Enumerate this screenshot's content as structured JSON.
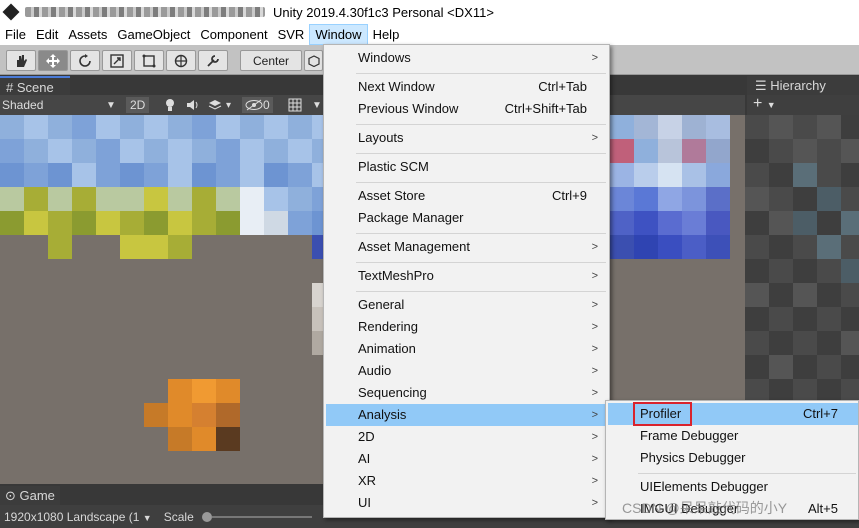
{
  "window": {
    "title": "Unity 2019.4.30f1c3 Personal <DX11>"
  },
  "menubar": {
    "items": [
      {
        "label": "File"
      },
      {
        "label": "Edit"
      },
      {
        "label": "Assets"
      },
      {
        "label": "GameObject"
      },
      {
        "label": "Component"
      },
      {
        "label": "SVR"
      },
      {
        "label": "Window"
      },
      {
        "label": "Help"
      }
    ]
  },
  "toolbar": {
    "pivot_label": "Center"
  },
  "scene": {
    "tab_label": "Scene",
    "shading_mode": "Shaded",
    "mode_2d": "2D",
    "hidden_count": "0"
  },
  "hierarchy": {
    "tab_label": "Hierarchy",
    "add_label": "+"
  },
  "game": {
    "tab_label": "Game",
    "resolution": "1920x1080 Landscape (1",
    "scale_label": "Scale"
  },
  "window_menu": {
    "items": [
      {
        "label": "Windows",
        "shortcut": "",
        "submenu": true
      },
      {
        "label": "Next Window",
        "shortcut": "Ctrl+Tab",
        "submenu": false
      },
      {
        "label": "Previous Window",
        "shortcut": "Ctrl+Shift+Tab",
        "submenu": false
      },
      {
        "label": "Layouts",
        "shortcut": "",
        "submenu": true
      },
      {
        "label": "Plastic SCM",
        "shortcut": "",
        "submenu": false
      },
      {
        "label": "Asset Store",
        "shortcut": "Ctrl+9",
        "submenu": false
      },
      {
        "label": "Package Manager",
        "shortcut": "",
        "submenu": false
      },
      {
        "label": "Asset Management",
        "shortcut": "",
        "submenu": true
      },
      {
        "label": "TextMeshPro",
        "shortcut": "",
        "submenu": true
      },
      {
        "label": "General",
        "shortcut": "",
        "submenu": true
      },
      {
        "label": "Rendering",
        "shortcut": "",
        "submenu": true
      },
      {
        "label": "Animation",
        "shortcut": "",
        "submenu": true
      },
      {
        "label": "Audio",
        "shortcut": "",
        "submenu": true
      },
      {
        "label": "Sequencing",
        "shortcut": "",
        "submenu": true
      },
      {
        "label": "Analysis",
        "shortcut": "",
        "submenu": true
      },
      {
        "label": "2D",
        "shortcut": "",
        "submenu": true
      },
      {
        "label": "AI",
        "shortcut": "",
        "submenu": true
      },
      {
        "label": "XR",
        "shortcut": "",
        "submenu": true
      },
      {
        "label": "UI",
        "shortcut": "",
        "submenu": true
      }
    ]
  },
  "analysis_menu": {
    "items": [
      {
        "label": "Profiler",
        "shortcut": "Ctrl+7"
      },
      {
        "label": "Frame Debugger",
        "shortcut": ""
      },
      {
        "label": "Physics Debugger",
        "shortcut": ""
      },
      {
        "label": "UIElements Debugger",
        "shortcut": ""
      },
      {
        "label": "IMGUI Debugger",
        "shortcut": "Alt+5"
      }
    ]
  },
  "watermark": "CSDN @呆呆敲代码的小Y",
  "colors": {
    "highlight": "#91c9f7",
    "callout": "#d9232d",
    "menu_active": "#cce8ff"
  }
}
